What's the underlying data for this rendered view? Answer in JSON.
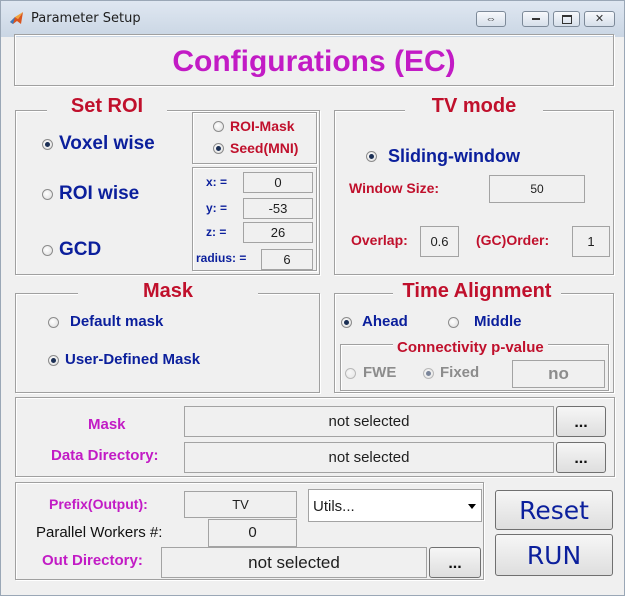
{
  "window": {
    "title": "Parameter Setup"
  },
  "header": {
    "title": "Configurations (EC)"
  },
  "set_roi": {
    "title": "Set ROI",
    "options": {
      "voxel": "Voxel wise",
      "roi": "ROI wise",
      "gcd": "GCD"
    },
    "selected": "voxel",
    "roi_type": {
      "mask": "ROI-Mask",
      "seed": "Seed(MNI)",
      "selected": "seed"
    },
    "coords": {
      "x_label": "x: =",
      "x_value": "0",
      "y_label": "y: =",
      "y_value": "-53",
      "z_label": "z: =",
      "z_value": "26",
      "radius_label": "radius: =",
      "radius_value": "6"
    }
  },
  "tv_mode": {
    "title": "TV mode",
    "sliding_label": "Sliding-window",
    "window_size_label": "Window Size:",
    "window_size_value": "50",
    "overlap_label": "Overlap:",
    "overlap_value": "0.6",
    "order_label": "(GC)Order:",
    "order_value": "1"
  },
  "mask": {
    "title": "Mask",
    "default_label": "Default mask",
    "user_defined_label": "User-Defined Mask",
    "selected": "user_defined"
  },
  "time_alignment": {
    "title": "Time Alignment",
    "ahead_label": "Ahead",
    "middle_label": "Middle",
    "selected": "ahead",
    "pvalue": {
      "title": "Connectivity p-value",
      "fwe_label": "FWE",
      "fixed_label": "Fixed",
      "value": "no"
    }
  },
  "paths": {
    "mask_label": "Mask",
    "mask_value": "not selected",
    "data_dir_label": "Data Directory:",
    "data_dir_value": "not selected",
    "browse_label": "..."
  },
  "output": {
    "prefix_label": "Prefix(Output):",
    "prefix_value": "TV",
    "utils_value": "Utils...",
    "workers_label": "Parallel Workers #:",
    "workers_value": "0",
    "out_dir_label": "Out Directory:",
    "out_dir_value": "not selected",
    "browse_label": "..."
  },
  "actions": {
    "reset_label": "Reset",
    "run_label": "RUN"
  },
  "colors": {
    "heading_red": "#c0102c",
    "magenta": "#c21bc5",
    "blue": "#0b1f9c"
  },
  "icons": [
    "matlab-icon",
    "restore-icon",
    "minimize-icon",
    "maximize-icon",
    "close-icon",
    "dropdown-arrow-icon"
  ]
}
